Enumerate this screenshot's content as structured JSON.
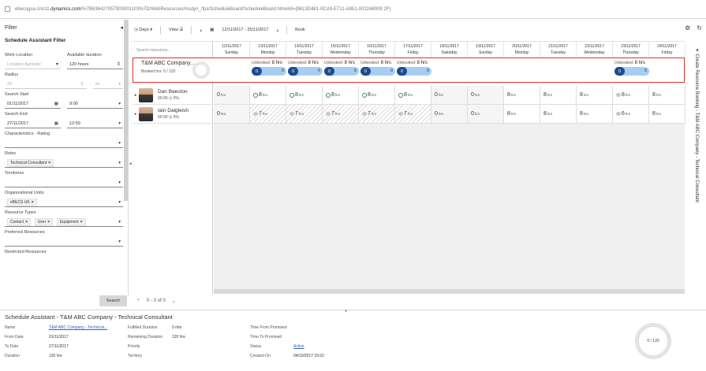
{
  "url": {
    "prefix": "ebecsgsa.crm11.",
    "domain": "dynamics.com",
    "path": "/%7B636427057900001103%7D/WebResources/msdyn_/fps/ScheduleBoard/ScheduleBoard.html#id={8613D481-0CA9-E711-A851-002248009 2F}"
  },
  "filter": {
    "header": "Filter",
    "collapse_icon": "chevron-left-icon",
    "title": "Schedule Assistant Filter",
    "work_location": {
      "label": "Work Location",
      "value": "Location Agnostic"
    },
    "available_duration": {
      "label": "Available duration",
      "value": "120 hours"
    },
    "radius": {
      "label": "Radius",
      "value": "20",
      "unit": "mi"
    },
    "search_start": {
      "label": "Search Start",
      "date": "01/11/2017",
      "time": "9:00"
    },
    "search_end": {
      "label": "Search End",
      "date": "27/11/2017",
      "time": "12:59"
    },
    "characteristics": {
      "label": "Characteristics - Rating"
    },
    "roles": {
      "label": "Roles",
      "tags": [
        "Technical Consultant"
      ]
    },
    "territories": {
      "label": "Territories"
    },
    "org_units": {
      "label": "Organizational Units",
      "tags": [
        "eBECS UK"
      ]
    },
    "resource_types": {
      "label": "Resource Types",
      "tags": [
        "Contact",
        "User",
        "Equipment"
      ]
    },
    "preferred": {
      "label": "Preferred Resources"
    },
    "restricted": {
      "label": "Restricted Resources"
    },
    "search_button": "Search"
  },
  "toolbar": {
    "days": "Days",
    "view": "View",
    "range": "12/11/2017 - 25/11/2017",
    "book": "Book"
  },
  "resources": {
    "search_placeholder": "Search resources...",
    "rows": [
      {
        "name": "Dan Beeston",
        "sub": "00:00 ◷   0%"
      },
      {
        "name": "Iain Dalgleish",
        "sub": "00:00 ◷   0%"
      }
    ]
  },
  "days": [
    {
      "date": "12/11/2017",
      "day": "Sunday"
    },
    {
      "date": "13/11/2017",
      "day": "Monday"
    },
    {
      "date": "14/11/2017",
      "day": "Tuesday"
    },
    {
      "date": "15/11/2017",
      "day": "Wednesday"
    },
    {
      "date": "16/11/2017",
      "day": "Thursday"
    },
    {
      "date": "17/11/2017",
      "day": "Friday"
    },
    {
      "date": "18/11/2017",
      "day": "Saturday"
    },
    {
      "date": "19/11/2017",
      "day": "Sunday"
    },
    {
      "date": "20/11/2017",
      "day": "Monday"
    },
    {
      "date": "21/11/2017",
      "day": "Tuesday"
    },
    {
      "date": "22/11/2017",
      "day": "Wednesday"
    },
    {
      "date": "23/11/2017",
      "day": "Thursday"
    },
    {
      "date": "24/11/2017",
      "day": "Friday"
    }
  ],
  "requirement": {
    "title": "T&M ABC Company...",
    "booked": "Booked hrs: 0 / 120",
    "unbooked_label": "Unbooked:",
    "unbooked_value": "8 hrs",
    "badge": "0",
    "bar_value": "8"
  },
  "grid": {
    "dan": [
      "0",
      "8",
      "8",
      "8",
      "8",
      "8",
      "0",
      "0",
      "8",
      "8",
      "8",
      "8",
      "8"
    ],
    "iain": [
      "0",
      "7",
      "7",
      "7",
      "7",
      "7",
      "0",
      "0",
      "8",
      "8",
      "8",
      "6",
      "8"
    ],
    "hrs": "hrs"
  },
  "side_label": "Create Resource Booking - T&M ABC Company - Technical Consultant",
  "pager": "0 - 0 of 0",
  "details": {
    "title": "Schedule Assistant - T&M ABC Company - Technical Consultant",
    "name_lbl": "Name",
    "name_val": "T&M ABC Company - Technical...",
    "from_lbl": "From Date",
    "from_val": "01/11/2017",
    "to_lbl": "To Date",
    "to_val": "27/11/2017",
    "duration_lbl": "Duration",
    "duration_val": "120 hrs",
    "fulfilled_lbl": "Fulfilled Duration",
    "fulfilled_val": "0 min",
    "remaining_lbl": "Remaining Duration",
    "remaining_val": "120 hrs",
    "priority_lbl": "Priority",
    "territory_lbl": "Territory",
    "tfp_lbl": "Time From Promised",
    "ttp_lbl": "Time To Promised",
    "status_lbl": "Status",
    "status_val": "Active",
    "created_lbl": "Created On",
    "created_val": "04/10/2017 15:02",
    "ring": "0 / 120"
  }
}
